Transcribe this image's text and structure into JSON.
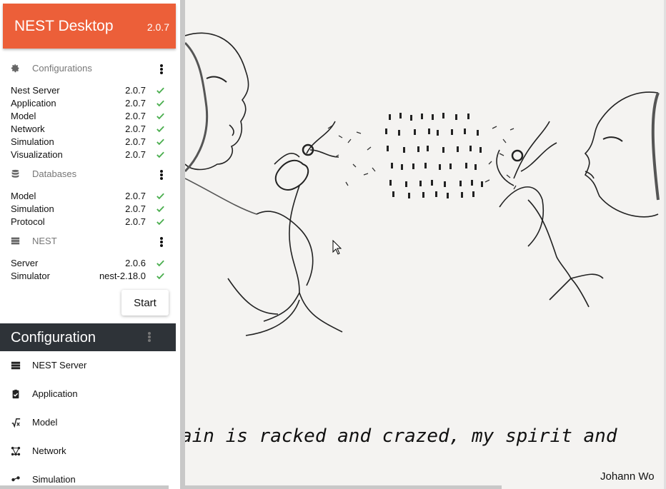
{
  "app": {
    "title": "NEST Desktop",
    "version": "2.0.7"
  },
  "configurations": {
    "title": "Configurations",
    "icon": "gear-icon",
    "items": [
      {
        "label": "Nest Server",
        "value": "2.0.7"
      },
      {
        "label": "Application",
        "value": "2.0.7"
      },
      {
        "label": "Model",
        "value": "2.0.7"
      },
      {
        "label": "Network",
        "value": "2.0.7"
      },
      {
        "label": "Simulation",
        "value": "2.0.7"
      },
      {
        "label": "Visualization",
        "value": "2.0.7"
      }
    ]
  },
  "databases": {
    "title": "Databases",
    "icon": "database-icon",
    "items": [
      {
        "label": "Model",
        "value": "2.0.7"
      },
      {
        "label": "Simulation",
        "value": "2.0.7"
      },
      {
        "label": "Protocol",
        "value": "2.0.7"
      }
    ]
  },
  "nest": {
    "title": "NEST",
    "icon": "server-icon",
    "items": [
      {
        "label": "Server",
        "value": "2.0.6"
      },
      {
        "label": "Simulator",
        "value": "nest-2.18.0"
      }
    ]
  },
  "start_button": "Start",
  "configuration_panel": {
    "title": "Configuration",
    "items": [
      {
        "label": "NEST Server",
        "icon": "server-icon"
      },
      {
        "label": "Application",
        "icon": "clipboard-check-icon"
      },
      {
        "label": "Model",
        "icon": "function-icon"
      },
      {
        "label": "Network",
        "icon": "graph-icon"
      },
      {
        "label": "Simulation",
        "icon": "simulation-icon"
      }
    ]
  },
  "content": {
    "quote": "ain is racked and crazed, my spirit and",
    "author": "Johann Wo"
  },
  "colors": {
    "brand": "#ec5f39",
    "check": "#4caf50",
    "config_bar": "#2e3338"
  }
}
